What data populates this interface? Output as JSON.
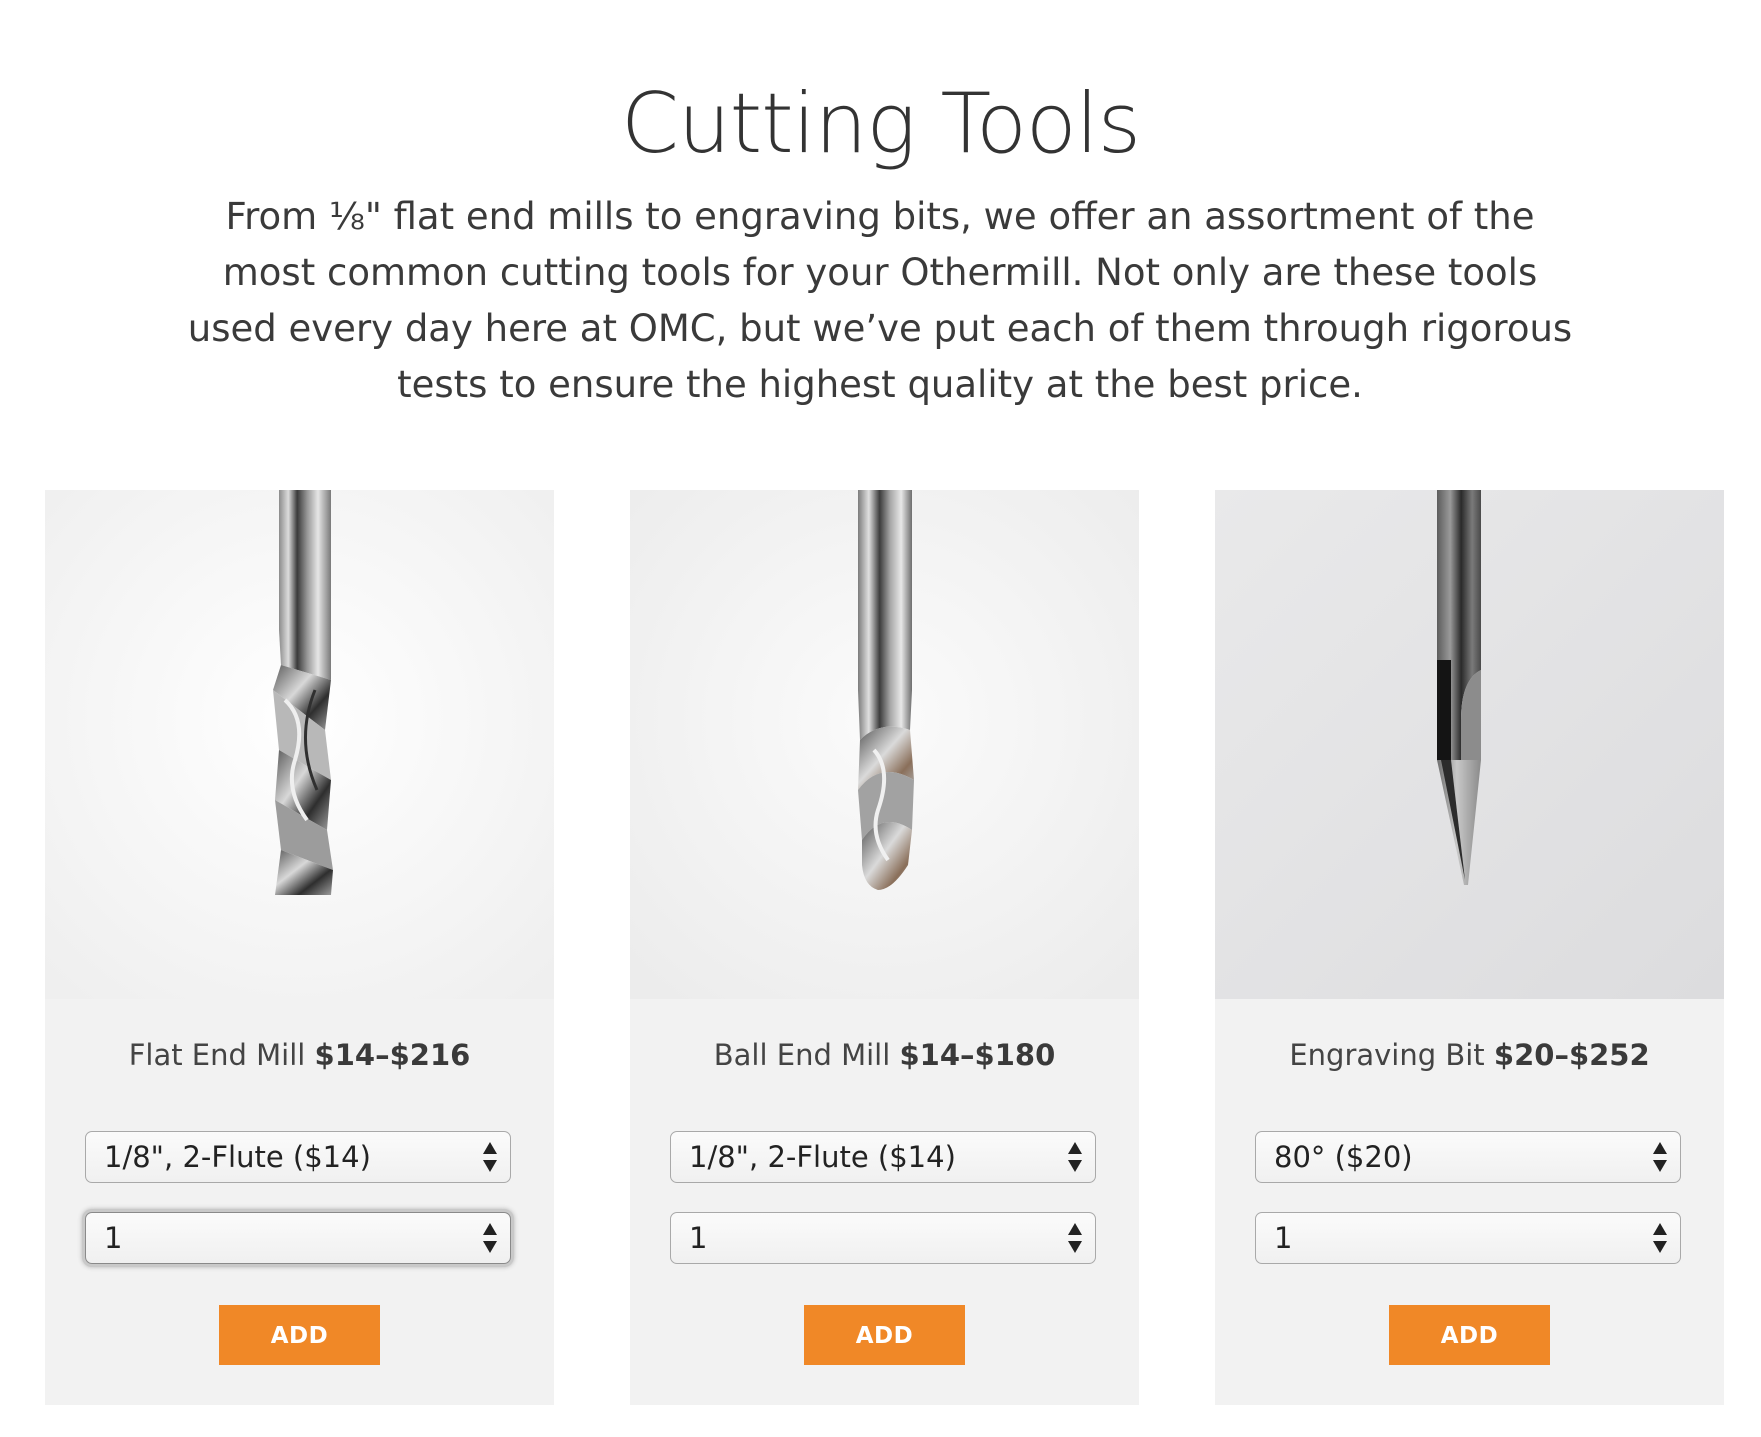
{
  "page": {
    "title": "Cutting Tools",
    "intro": "From ⅛\" flat end mills to engraving bits, we offer an assortment of the most common cutting tools for your Othermill. Not only are these tools used every day here at OMC, but we’ve put each of them through rigorous tests to ensure the highest quality at the best price."
  },
  "colors": {
    "accent": "#f08827",
    "card_background": "#f2f2f2"
  },
  "products": [
    {
      "name": "Flat End Mill",
      "price": "$14–$216",
      "image_icon": "flat-end-mill-image",
      "variant_selected": "1/8\", 2-Flute ($14)",
      "quantity_selected": "1",
      "add_label": "ADD"
    },
    {
      "name": "Ball End Mill",
      "price": "$14–$180",
      "image_icon": "ball-end-mill-image",
      "variant_selected": "1/8\", 2-Flute ($14)",
      "quantity_selected": "1",
      "add_label": "ADD"
    },
    {
      "name": "Engraving Bit",
      "price": "$20–$252",
      "image_icon": "engraving-bit-image",
      "variant_selected": "80° ($20)",
      "quantity_selected": "1",
      "add_label": "ADD"
    }
  ]
}
